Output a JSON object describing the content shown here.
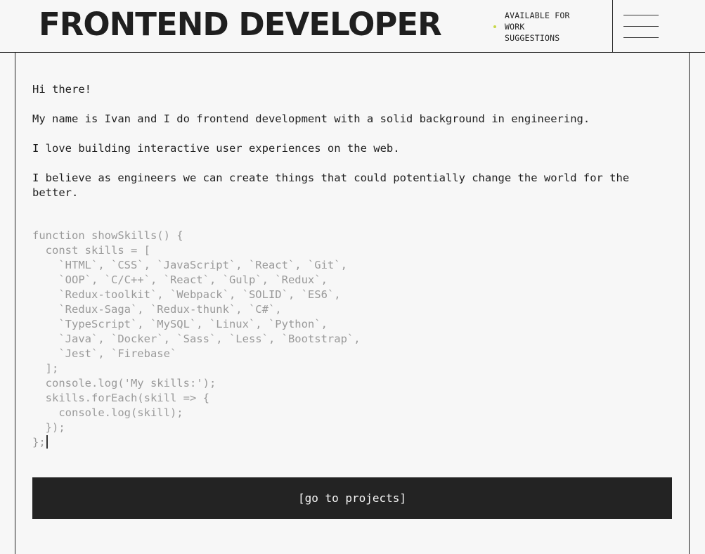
{
  "header": {
    "logo": "FRONTEND DEVELOPER",
    "status_lines": [
      "AVAILABLE FOR",
      "WORK",
      "SUGGESTIONS"
    ],
    "status_color": "#c8d84a",
    "menu_icon": "hamburger-menu-icon"
  },
  "intro": {
    "greeting": "Hi there!",
    "line1": "My name is Ivan and I do frontend development with a solid background in engineering.",
    "line2": "I love building interactive user experiences on the web.",
    "line3": "I believe as engineers we can create things that could potentially change the world for the better."
  },
  "code": {
    "lines": [
      "function showSkills() {",
      "  const skills = [",
      "    `HTML`, `CSS`, `JavaScript`, `React`, `Git`,",
      "    `OOP`, `C/C++`, `React`, `Gulp`, `Redux`,",
      "    `Redux-toolkit`, `Webpack`, `SOLID`, `ES6`,",
      "    `Redux-Saga`, `Redux-thunk`, `C#`,",
      "    `TypeScript`, `MySQL`, `Linux`, `Python`,",
      "    `Java`, `Docker`, `Sass`, `Less`, `Bootstrap`,",
      "    `Jest`, `Firebase`",
      "  ];",
      "  console.log('My skills:');",
      "  skills.forEach(skill => {",
      "    console.log(skill);",
      "  });",
      "};"
    ]
  },
  "cta": {
    "label": "[go to projects]"
  }
}
